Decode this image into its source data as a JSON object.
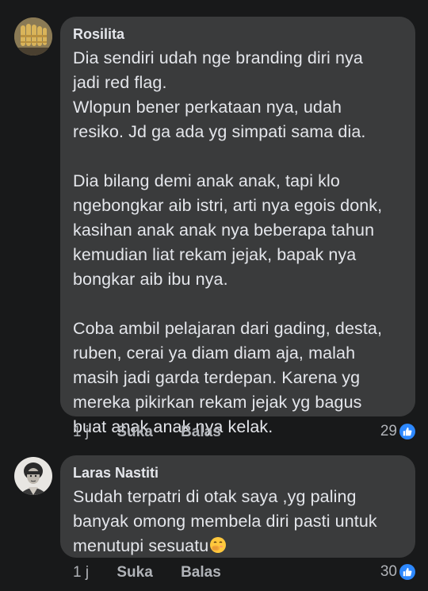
{
  "comments": [
    {
      "author": "Rosilita",
      "text": "Dia sendiri udah nge branding diri nya\njadi red flag.\nWlopun bener perkataan nya, udah\nresiko. Jd ga ada yg simpati sama dia.\n\nDia bilang demi anak anak, tapi klo\nngebongkar aib istri, arti nya egois donk,\nkasihan anak anak nya beberapa tahun\nkemudian liat rekam jejak, bapak nya\nbongkar aib ibu nya.\n\nCoba ambil pelajaran dari gading, desta,\nruben, cerai ya diam diam aja, malah\nmasih jadi garda terdepan. Karena yg\nmereka pikirkan rekam jejak yg bagus\nbuat anak anak nya kelak.",
      "time": "1 j",
      "like_label": "Suka",
      "reply_label": "Balas",
      "reaction_count": "29",
      "reaction_icon": "thumbs-up-icon"
    },
    {
      "author": "Laras Nastiti",
      "text": "Sudah terpatri di otak saya ,yg paling\nbanyak omong membela diri pasti untuk\nmenutupi sesuatu",
      "emoji": "face-with-hand-over-mouth",
      "time": "1 j",
      "like_label": "Suka",
      "reply_label": "Balas",
      "reaction_count": "30",
      "reaction_icon": "thumbs-up-icon"
    }
  ],
  "colors": {
    "background": "#18191a",
    "bubble": "#3a3b3c",
    "text": "#e4e6eb",
    "secondary_text": "#b0b3b8",
    "like_blue": "#2d88ff"
  }
}
